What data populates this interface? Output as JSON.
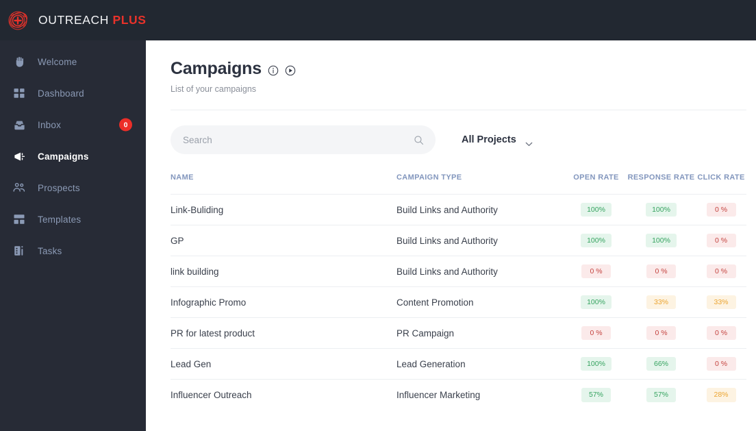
{
  "brand": {
    "logo_icon": "target-plus-logo-icon",
    "name_primary": "OUTREACH",
    "name_accent": "PLUS",
    "accent_color": "#e8322a"
  },
  "sidebar": {
    "items": [
      {
        "label": "Welcome",
        "icon": "hand-wave-icon",
        "active": false,
        "badge": null
      },
      {
        "label": "Dashboard",
        "icon": "grid-icon",
        "active": false,
        "badge": null
      },
      {
        "label": "Inbox",
        "icon": "inbox-tray-icon",
        "active": false,
        "badge": "0"
      },
      {
        "label": "Campaigns",
        "icon": "megaphone-icon",
        "active": true,
        "badge": null
      },
      {
        "label": "Prospects",
        "icon": "people-icon",
        "active": false,
        "badge": null
      },
      {
        "label": "Templates",
        "icon": "layout-icon",
        "active": false,
        "badge": null
      },
      {
        "label": "Tasks",
        "icon": "tasks-list-icon",
        "active": false,
        "badge": null
      }
    ]
  },
  "page": {
    "title": "Campaigns",
    "subtitle": "List of your campaigns",
    "info_icon": "info-circle-icon",
    "play_icon": "play-circle-icon"
  },
  "search": {
    "value": "",
    "placeholder": "Search",
    "icon": "search-icon"
  },
  "project_filter": {
    "selected": "All Projects",
    "caret_icon": "chevron-down-icon"
  },
  "table": {
    "columns": [
      {
        "key": "name",
        "label": "Name"
      },
      {
        "key": "campaign_type",
        "label": "Campaign Type"
      },
      {
        "key": "open_rate",
        "label": "Open Rate"
      },
      {
        "key": "response_rate",
        "label": "Response Rate"
      },
      {
        "key": "click_rate",
        "label": "Click Rate"
      }
    ],
    "rows": [
      {
        "name": "Link-Buliding",
        "campaign_type": "Build Links and Authority",
        "open_rate": {
          "text": "100%",
          "tone": "green"
        },
        "response_rate": {
          "text": "100%",
          "tone": "green"
        },
        "click_rate": {
          "text": "0 %",
          "tone": "red"
        }
      },
      {
        "name": "GP",
        "campaign_type": "Build Links and Authority",
        "open_rate": {
          "text": "100%",
          "tone": "green"
        },
        "response_rate": {
          "text": "100%",
          "tone": "green"
        },
        "click_rate": {
          "text": "0 %",
          "tone": "red"
        }
      },
      {
        "name": "link building",
        "campaign_type": "Build Links and Authority",
        "open_rate": {
          "text": "0 %",
          "tone": "red"
        },
        "response_rate": {
          "text": "0 %",
          "tone": "red"
        },
        "click_rate": {
          "text": "0 %",
          "tone": "red"
        }
      },
      {
        "name": "Infographic Promo",
        "campaign_type": "Content Promotion",
        "open_rate": {
          "text": "100%",
          "tone": "green"
        },
        "response_rate": {
          "text": "33%",
          "tone": "orange"
        },
        "click_rate": {
          "text": "33%",
          "tone": "orange"
        }
      },
      {
        "name": "PR for latest product",
        "campaign_type": "PR Campaign",
        "open_rate": {
          "text": "0 %",
          "tone": "red"
        },
        "response_rate": {
          "text": "0 %",
          "tone": "red"
        },
        "click_rate": {
          "text": "0 %",
          "tone": "red"
        }
      },
      {
        "name": "Lead Gen",
        "campaign_type": "Lead Generation",
        "open_rate": {
          "text": "100%",
          "tone": "green"
        },
        "response_rate": {
          "text": "66%",
          "tone": "green"
        },
        "click_rate": {
          "text": "0 %",
          "tone": "red"
        }
      },
      {
        "name": "Influencer Outreach",
        "campaign_type": "Influencer Marketing",
        "open_rate": {
          "text": "57%",
          "tone": "green"
        },
        "response_rate": {
          "text": "57%",
          "tone": "green"
        },
        "click_rate": {
          "text": "28%",
          "tone": "orange"
        }
      }
    ]
  },
  "colors": {
    "topbar_bg": "#222831",
    "sidebar_bg": "#272b36",
    "badge_green_bg": "#e5f5ec",
    "badge_green_fg": "#35a35f",
    "badge_red_bg": "#fbeaea",
    "badge_red_fg": "#c4433f",
    "badge_orange_bg": "#fdf3e2",
    "badge_orange_fg": "#eba430",
    "inbox_badge_bg": "#ec2e28",
    "column_header_fg": "#8296bd"
  }
}
